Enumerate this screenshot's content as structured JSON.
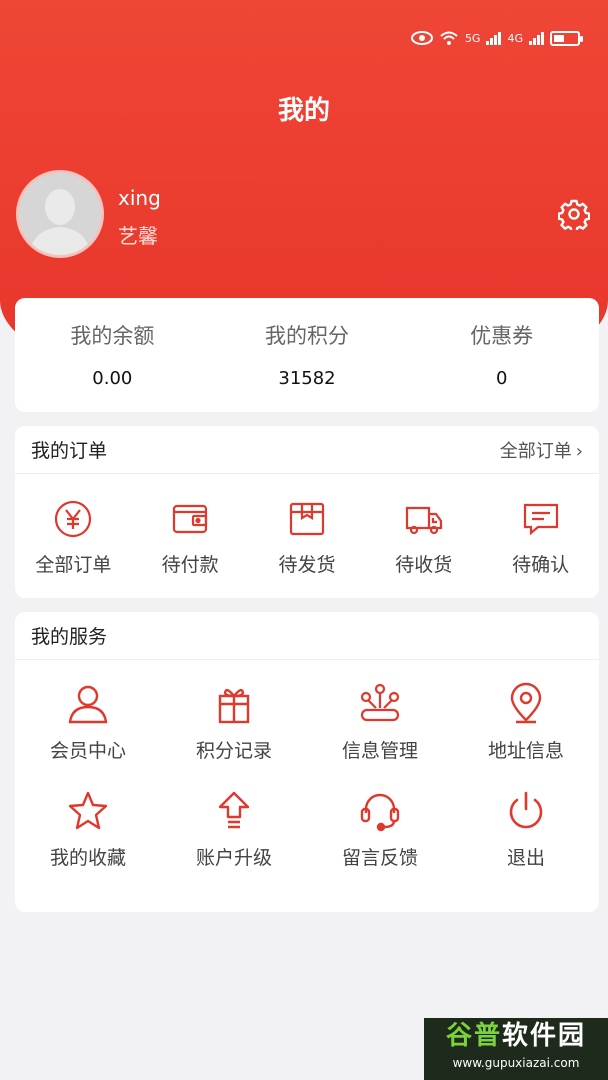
{
  "header": {
    "title": "我的",
    "status_icons": [
      "eye-icon",
      "wifi-icon",
      "signal-icon",
      "signal-icon",
      "battery-icon"
    ],
    "status_labels": [
      "5G",
      "4G"
    ],
    "accent_color": "#e8352b"
  },
  "profile": {
    "username": "xing",
    "nickname": "艺馨"
  },
  "balance": [
    {
      "label": "我的余额",
      "value": "0.00"
    },
    {
      "label": "我的积分",
      "value": "31582"
    },
    {
      "label": "优惠券",
      "value": "0"
    }
  ],
  "orders": {
    "title": "我的订单",
    "all_link": "全部订单",
    "items": [
      {
        "label": "全部订单",
        "icon": "yen-icon"
      },
      {
        "label": "待付款",
        "icon": "wallet-icon"
      },
      {
        "label": "待发货",
        "icon": "box-icon"
      },
      {
        "label": "待收货",
        "icon": "truck-icon"
      },
      {
        "label": "待确认",
        "icon": "message-icon"
      }
    ]
  },
  "services": {
    "title": "我的服务",
    "items": [
      {
        "label": "会员中心",
        "icon": "user-icon"
      },
      {
        "label": "积分记录",
        "icon": "gift-icon"
      },
      {
        "label": "信息管理",
        "icon": "network-icon"
      },
      {
        "label": "地址信息",
        "icon": "location-icon"
      },
      {
        "label": "我的收藏",
        "icon": "star-icon"
      },
      {
        "label": "账户升级",
        "icon": "upgrade-icon"
      },
      {
        "label": "留言反馈",
        "icon": "headset-icon"
      },
      {
        "label": "退出",
        "icon": "power-icon"
      }
    ]
  },
  "watermark": {
    "line1a": "谷普",
    "line1b": "软件园",
    "line2": "www.gupuxiazai.com"
  }
}
